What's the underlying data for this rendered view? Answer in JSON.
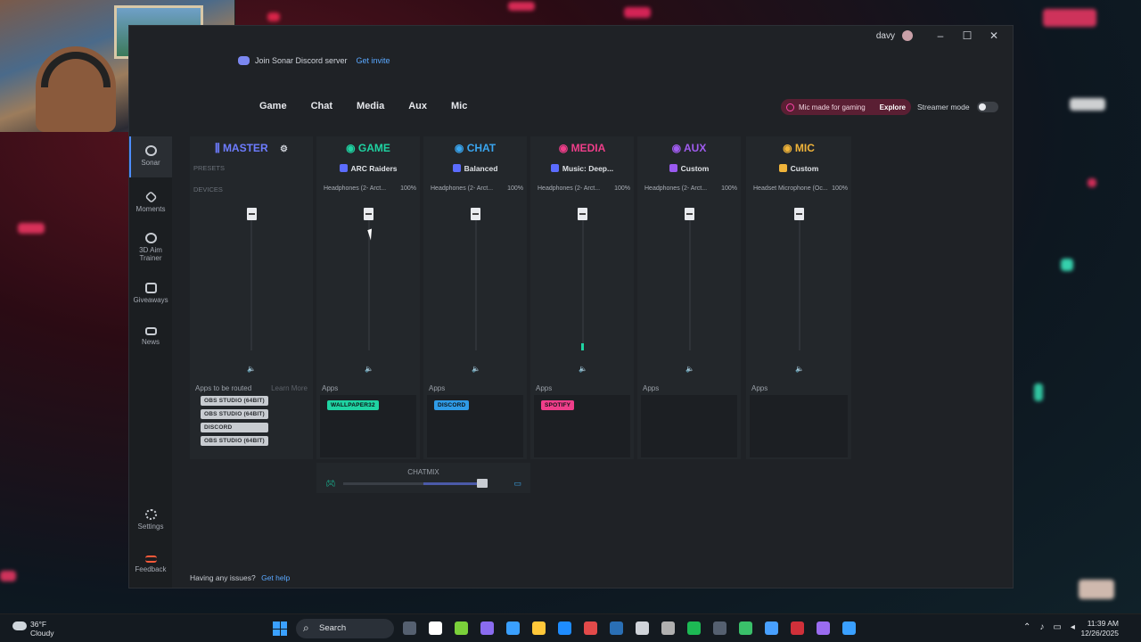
{
  "window": {
    "user": "davy",
    "controls": [
      "–",
      "☐",
      "✕"
    ]
  },
  "discord_banner": {
    "text": "Join Sonar Discord server",
    "link": "Get invite"
  },
  "tabs": [
    "Game",
    "Chat",
    "Media",
    "Aux",
    "Mic"
  ],
  "mic_banner": {
    "text": "Mic made for gaming",
    "action": "Explore"
  },
  "streamer_mode": {
    "label": "Streamer mode",
    "enabled": false
  },
  "sidebar": [
    {
      "label": "Sonar",
      "icon": "sonar-icon"
    },
    {
      "label": "Moments",
      "icon": "moments-icon"
    },
    {
      "label": "3D Aim",
      "label2": "Trainer",
      "icon": "aim-trainer-icon"
    },
    {
      "label": "Giveaways",
      "icon": "gift-icon"
    },
    {
      "label": "News",
      "icon": "news-icon"
    },
    {
      "label": "Settings",
      "icon": "gear-icon"
    },
    {
      "label": "Feedback",
      "icon": "feedback-icon"
    }
  ],
  "master": {
    "title": "MASTER",
    "presets_label": "PRESETS",
    "devices_label": "DEVICES",
    "apps_label": "Apps to be routed",
    "learn_more": "Learn More",
    "apps": [
      "OBS STUDIO (64BIT)",
      "OBS STUDIO (64BIT)",
      "DISCORD",
      "OBS STUDIO (64BIT)"
    ],
    "color": "#6d7cff"
  },
  "channels": [
    {
      "key": "game",
      "title": "GAME",
      "color": "#1fd3a2",
      "preset": "ARC Raiders",
      "preset_color": "#5b6cff",
      "device": "Headphones (2- Arct...",
      "percent": "100%",
      "apps_label": "Apps",
      "apps": [
        "WALLPAPER32"
      ],
      "chip_color": "#1fd3a2",
      "level": 0
    },
    {
      "key": "chat",
      "title": "CHAT",
      "color": "#3aa6f0",
      "preset": "Balanced",
      "preset_color": "#5b6cff",
      "device": "Headphones (2- Arct...",
      "percent": "100%",
      "apps_label": "Apps",
      "apps": [
        "DISCORD"
      ],
      "chip_color": "#2f9be6",
      "level": 0
    },
    {
      "key": "media",
      "title": "MEDIA",
      "color": "#ef3e8a",
      "preset": "Music: Deep...",
      "preset_color": "#5b6cff",
      "device": "Headphones (2- Arct...",
      "percent": "100%",
      "apps_label": "Apps",
      "apps": [
        "SPOTIFY"
      ],
      "chip_color": "#ef3e8a",
      "level": 0.05
    },
    {
      "key": "aux",
      "title": "AUX",
      "color": "#a05cf0",
      "preset": "Custom",
      "preset_color": "#9a5af0",
      "device": "Headphones (2- Arct...",
      "percent": "100%",
      "apps_label": "Apps",
      "apps": [],
      "chip_color": "#a05cf0",
      "level": 0
    },
    {
      "key": "mic",
      "title": "MIC",
      "color": "#f0b43a",
      "preset": "Custom",
      "preset_color": "#f0b43a",
      "device": "Headset Microphone (Oc...",
      "percent": "100%",
      "apps_label": "Apps",
      "apps": [],
      "chip_color": "#f0b43a",
      "level": 0
    }
  ],
  "chatmix": {
    "label": "CHATMIX",
    "balance": 0.78
  },
  "help": {
    "text": "Having any issues?",
    "link": "Get help"
  },
  "taskbar": {
    "weather_temp": "36°F",
    "weather_desc": "Cloudy",
    "search": "Search",
    "time": "11:39 AM",
    "date": "12/26/2025"
  }
}
